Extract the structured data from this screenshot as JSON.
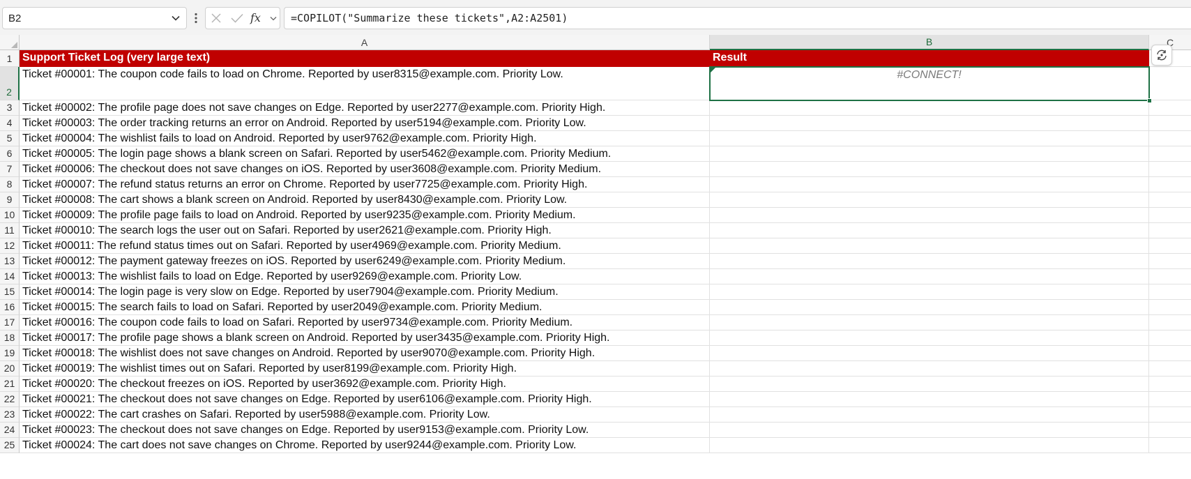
{
  "formula_bar": {
    "name_box": "B2",
    "formula": "=COPILOT(\"Summarize these tickets\",A2:A2501)"
  },
  "columns": [
    "A",
    "B",
    "C"
  ],
  "header_row": {
    "row_number": "1",
    "a": "Support Ticket Log (very large text)",
    "b": "Result"
  },
  "result_cell": "#CONNECT!",
  "rows": [
    {
      "n": "2",
      "text": "Ticket #00001: The coupon code fails to load on Chrome. Reported by user8315@example.com. Priority Low."
    },
    {
      "n": "3",
      "text": "Ticket #00002: The profile page does not save changes on Edge. Reported by user2277@example.com. Priority High."
    },
    {
      "n": "4",
      "text": "Ticket #00003: The order tracking returns an error on Android. Reported by user5194@example.com. Priority Low."
    },
    {
      "n": "5",
      "text": "Ticket #00004: The wishlist fails to load on Android. Reported by user9762@example.com. Priority High."
    },
    {
      "n": "6",
      "text": "Ticket #00005: The login page shows a blank screen on Safari. Reported by user5462@example.com. Priority Medium."
    },
    {
      "n": "7",
      "text": "Ticket #00006: The checkout does not save changes on iOS. Reported by user3608@example.com. Priority Medium."
    },
    {
      "n": "8",
      "text": "Ticket #00007: The refund status returns an error on Chrome. Reported by user7725@example.com. Priority High."
    },
    {
      "n": "9",
      "text": "Ticket #00008: The cart shows a blank screen on Android. Reported by user8430@example.com. Priority Low."
    },
    {
      "n": "10",
      "text": "Ticket #00009: The profile page fails to load on Android. Reported by user9235@example.com. Priority Medium."
    },
    {
      "n": "11",
      "text": "Ticket #00010: The search logs the user out on Safari. Reported by user2621@example.com. Priority High."
    },
    {
      "n": "12",
      "text": "Ticket #00011: The refund status times out on Safari. Reported by user4969@example.com. Priority Medium."
    },
    {
      "n": "13",
      "text": "Ticket #00012: The payment gateway freezes on iOS. Reported by user6249@example.com. Priority Medium."
    },
    {
      "n": "14",
      "text": "Ticket #00013: The wishlist fails to load on Edge. Reported by user9269@example.com. Priority Low."
    },
    {
      "n": "15",
      "text": "Ticket #00014: The login page is very slow on Edge. Reported by user7904@example.com. Priority Medium."
    },
    {
      "n": "16",
      "text": "Ticket #00015: The search fails to load on Safari. Reported by user2049@example.com. Priority Medium."
    },
    {
      "n": "17",
      "text": "Ticket #00016: The coupon code fails to load on Safari. Reported by user9734@example.com. Priority Medium."
    },
    {
      "n": "18",
      "text": "Ticket #00017: The profile page shows a blank screen on Android. Reported by user3435@example.com. Priority High."
    },
    {
      "n": "19",
      "text": "Ticket #00018: The wishlist does not save changes on Android. Reported by user9070@example.com. Priority High."
    },
    {
      "n": "20",
      "text": "Ticket #00019: The wishlist times out on Safari. Reported by user8199@example.com. Priority High."
    },
    {
      "n": "21",
      "text": "Ticket #00020: The checkout freezes on iOS. Reported by user3692@example.com. Priority High."
    },
    {
      "n": "22",
      "text": "Ticket #00021: The checkout does not save changes on Edge. Reported by user6106@example.com. Priority High."
    },
    {
      "n": "23",
      "text": "Ticket #00022: The cart crashes on Safari. Reported by user5988@example.com. Priority Low."
    },
    {
      "n": "24",
      "text": "Ticket #00023: The checkout does not save changes on Edge. Reported by user9153@example.com. Priority Low."
    },
    {
      "n": "25",
      "text": "Ticket #00024: The cart does not save changes on Chrome. Reported by user9244@example.com. Priority Low."
    }
  ],
  "colors": {
    "header_fill": "#C00000",
    "selection": "#1E7145",
    "error_text": "#7A7A7A"
  },
  "icons": {
    "name_box_dropdown": "chevron-down-icon",
    "more_options": "vertical-dots-icon",
    "cancel": "x-icon",
    "enter": "check-icon",
    "insert_function": "fx-icon",
    "copilot": "copilot-icon"
  }
}
